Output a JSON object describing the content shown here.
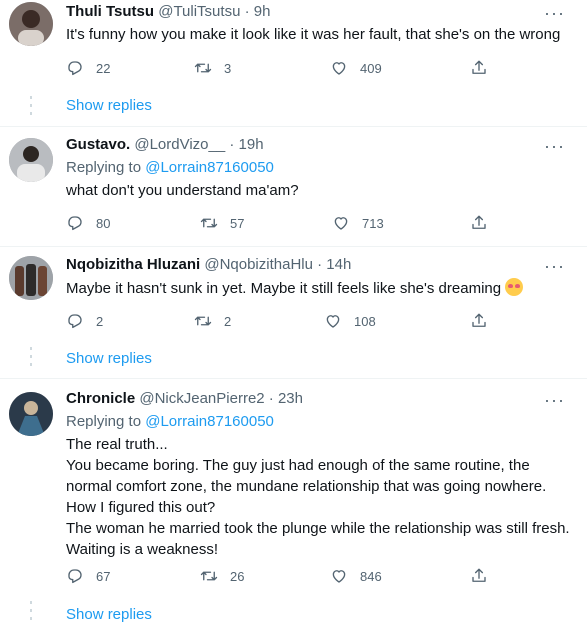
{
  "tweets": [
    {
      "name": "Thuli Tsutsu",
      "meta": "@TuliTsutsu · 9h",
      "replying_to_prefix": "",
      "replying_to_handle": "",
      "lines": [
        "It's funny how you make it look like it was her fault, that she's on the wrong"
      ],
      "replies": "22",
      "retweets": "3",
      "likes": "409",
      "show_replies": "Show replies"
    },
    {
      "name": "Gustavo.",
      "meta": "@LordVizo__ · 19h",
      "replying_to_prefix": "Replying to ",
      "replying_to_handle": "@Lorrain87160050",
      "lines": [
        "what don't you understand ma'am?"
      ],
      "replies": "80",
      "retweets": "57",
      "likes": "713",
      "show_replies": ""
    },
    {
      "name": "Nqobizitha Hluzani",
      "meta": "@NqobizithaHlu · 14h",
      "replying_to_prefix": "",
      "replying_to_handle": "",
      "lines": [
        "Maybe it hasn't sunk in yet. Maybe it still feels like she's dreaming"
      ],
      "emoji": "smiling-face-with-heart-eyes",
      "replies": "2",
      "retweets": "2",
      "likes": "108",
      "show_replies": "Show replies"
    },
    {
      "name": "Chronicle",
      "meta": "@NickJeanPierre2 · 23h",
      "replying_to_prefix": "Replying to ",
      "replying_to_handle": "@Lorrain87160050",
      "lines": [
        "The real truth...",
        "You became boring. The guy just had enough of the same routine, the",
        "normal comfort zone, the mundane relationship that was going nowhere.",
        "How I figured this out?",
        "The woman he married took the plunge while the relationship was still fresh.",
        "Waiting is a weakness!"
      ],
      "replies": "67",
      "retweets": "26",
      "likes": "846",
      "show_replies": "Show replies"
    }
  ],
  "icons": {
    "reply": "reply-icon",
    "retweet": "retweet-icon",
    "like": "heart-icon",
    "share": "share-icon",
    "more": "more-options-icon"
  },
  "colors": {
    "accent": "#1d9bf0",
    "secondary_text": "#536471",
    "primary_text": "#0f1419",
    "divider": "#eff3f4"
  }
}
